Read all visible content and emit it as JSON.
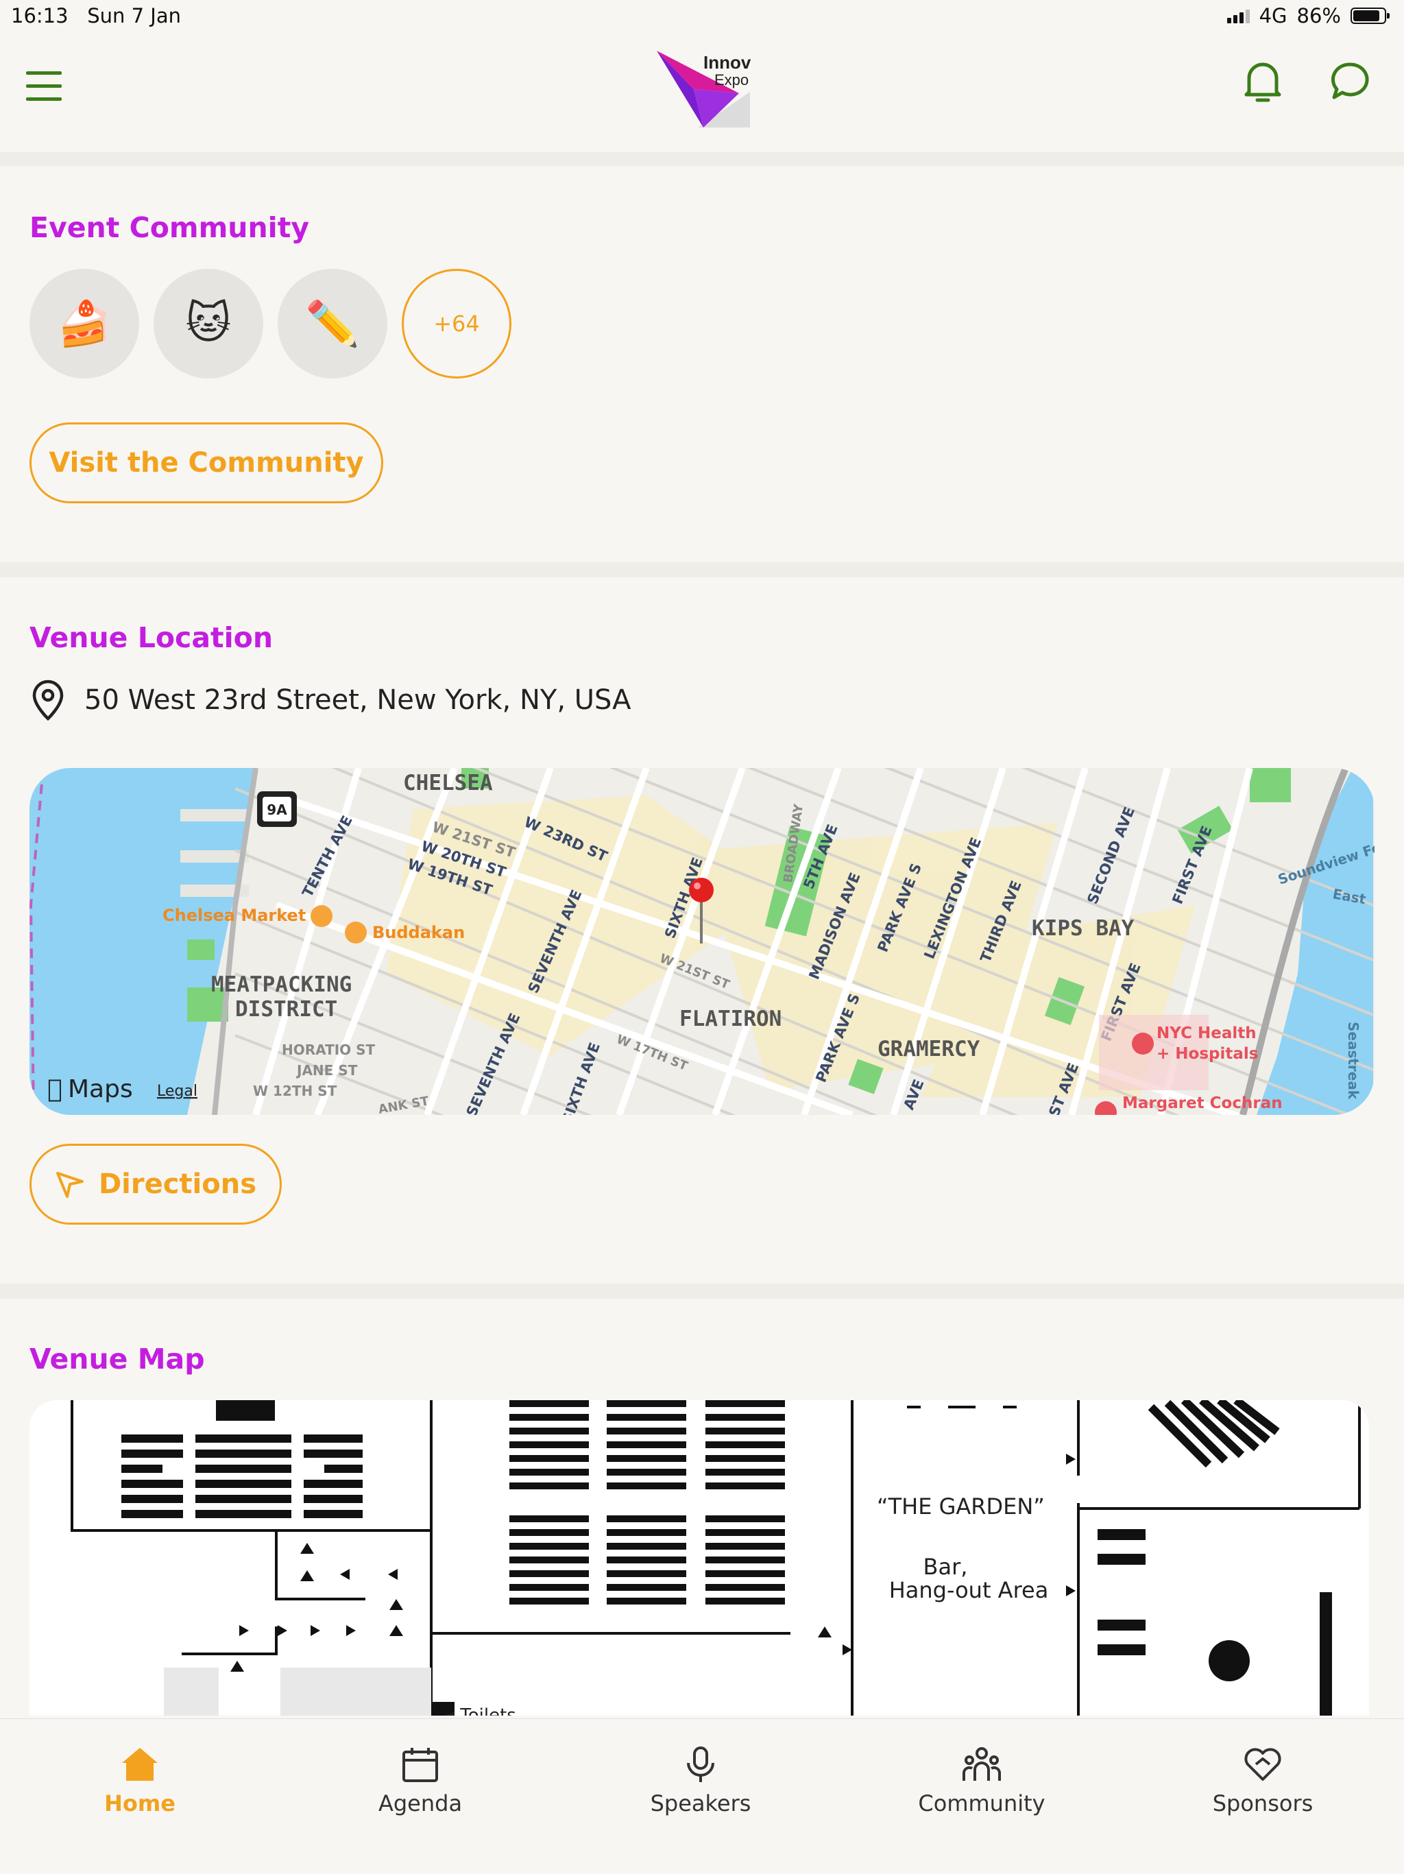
{
  "status_bar": {
    "time": "16:13",
    "date": "Sun 7 Jan",
    "network": "4G",
    "battery": "86%",
    "battery_level": 0.86
  },
  "header": {
    "logo_line1": "Innov",
    "logo_line2": "Expo"
  },
  "community": {
    "title": "Event Community",
    "avatars": [
      "🍰",
      "🐱",
      "✏️"
    ],
    "more_count": "+64",
    "visit_button": "Visit the Community"
  },
  "venue_location": {
    "title": "Venue Location",
    "address": "50 West 23rd Street, New York, NY, USA",
    "directions_button": "Directions",
    "map": {
      "neighborhoods": [
        "CHELSEA",
        "MEATPACKING",
        "DISTRICT",
        "FLATIRON",
        "GRAMERCY",
        "KIPS BAY"
      ],
      "streets": [
        "TENTH AVE",
        "W 21ST ST",
        "W 20TH ST",
        "W 19TH ST",
        "W 23RD ST",
        "SEVENTH AVE",
        "SIXTH AVE",
        "BROADWAY",
        "5TH AVE",
        "MADISON AVE",
        "PARK AVE S",
        "LEXINGTON AVE",
        "THIRD AVE",
        "SECOND AVE",
        "FIRST AVE",
        "W 21ST ST",
        "W 17TH ST",
        "HORATIO ST",
        "JANE ST",
        "W 12TH ST",
        "SEVENTH AVE",
        "SIXTH AVE",
        "PARK AVE S",
        "AVE",
        "FIRST AVE",
        "ST AVE",
        "ANK ST"
      ],
      "pois": [
        "Chelsea Market",
        "Buddakan",
        "NYC Health",
        "+ Hospitals",
        "Margaret Cochran"
      ],
      "water_labels": [
        "Soundview Fer",
        "East",
        "Seastreak"
      ],
      "route_shield": "9A",
      "brand": "Maps",
      "legal": "Legal"
    }
  },
  "venue_map": {
    "title": "Venue Map",
    "garden_label": "“THE GARDEN”",
    "bar_label_1": "Bar,",
    "bar_label_2": "Hang-out Area",
    "toilets_label": "◄ Toilets"
  },
  "tabs": [
    {
      "label": "Home",
      "icon": "home-icon",
      "active": true
    },
    {
      "label": "Agenda",
      "icon": "calendar-icon",
      "active": false
    },
    {
      "label": "Speakers",
      "icon": "microphone-icon",
      "active": false
    },
    {
      "label": "Community",
      "icon": "people-icon",
      "active": false
    },
    {
      "label": "Sponsors",
      "icon": "heart-handshake-icon",
      "active": false
    }
  ],
  "colors": {
    "accent_purple": "#c31ee0",
    "accent_orange": "#f2a21e",
    "nav_green": "#3a7d18",
    "background": "#f8f6f2"
  }
}
